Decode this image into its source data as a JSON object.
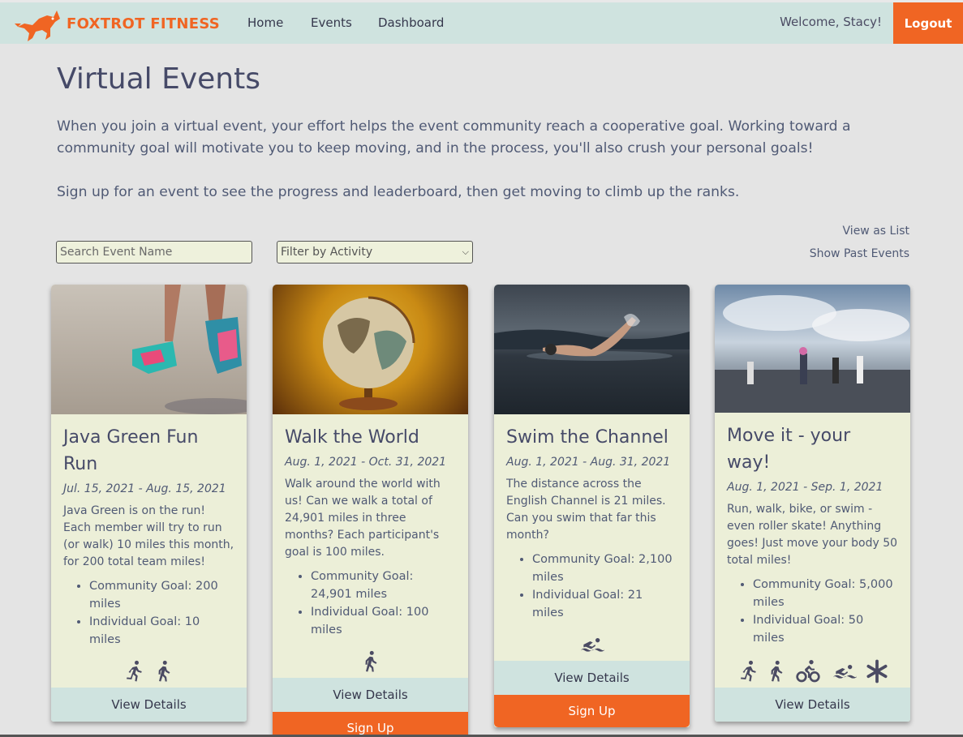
{
  "nav": {
    "brand": "FOXTROT FITNESS",
    "links": [
      "Home",
      "Events",
      "Dashboard"
    ],
    "welcome": "Welcome, Stacy!",
    "logout": "Logout"
  },
  "page": {
    "title": "Virtual Events",
    "intro": "When you join a virtual event, your effort helps the event community reach a cooperative goal. Working toward a community goal will motivate you to keep moving, and in the process, you'll also crush your personal goals!",
    "intro2": "Sign up for an event to see the progress and leaderboard, then get moving to climb up the ranks.",
    "view_as_list": "View as List",
    "show_past": "Show Past Events",
    "search_placeholder": "Search Event Name",
    "filter_selected": "Filter by Activity"
  },
  "colors": {
    "accent": "#f06523",
    "mint": "#cfe3df",
    "card": "#ecefd8",
    "text": "#464a68"
  },
  "events": [
    {
      "title": "Java Green Fun Run",
      "dates": "Jul. 15, 2021 - Aug. 15, 2021",
      "desc": "Java Green is on the run! Each member will try to run (or walk) 10 miles this month, for 200 total team miles!",
      "community_goal": "Community Goal: 200 miles",
      "individual_goal": "Individual Goal: 10 miles",
      "icons": [
        "run-icon",
        "walk-icon"
      ],
      "view_details": "View Details"
    },
    {
      "title": "Walk the World",
      "dates": "Aug. 1, 2021 - Oct. 31, 2021",
      "desc": "Walk around the world with us! Can we walk a total of 24,901 miles in three months? Each participant's goal is 100 miles.",
      "community_goal": "Community Goal: 24,901 miles",
      "individual_goal": "Individual Goal: 100 miles",
      "icons": [
        "walk-icon"
      ],
      "view_details": "View Details",
      "sign_up": "Sign Up"
    },
    {
      "title": "Swim the Channel",
      "dates": "Aug. 1, 2021 - Aug. 31, 2021",
      "desc": "The distance across the English Channel is 21 miles. Can you swim that far this month?",
      "community_goal": "Community Goal: 2,100 miles",
      "individual_goal": "Individual Goal: 21 miles",
      "icons": [
        "swim-icon"
      ],
      "view_details": "View Details",
      "sign_up": "Sign Up"
    },
    {
      "title": "Move it - your way!",
      "dates": "Aug. 1, 2021 - Sep. 1, 2021",
      "desc": "Run, walk, bike, or swim - even roller skate! Anything goes! Just move your body 50 total miles!",
      "community_goal": "Community Goal: 5,000 miles",
      "individual_goal": "Individual Goal: 50 miles",
      "icons": [
        "run-icon",
        "walk-icon",
        "bike-icon",
        "swim-icon",
        "asterisk-icon"
      ],
      "view_details": "View Details"
    }
  ]
}
